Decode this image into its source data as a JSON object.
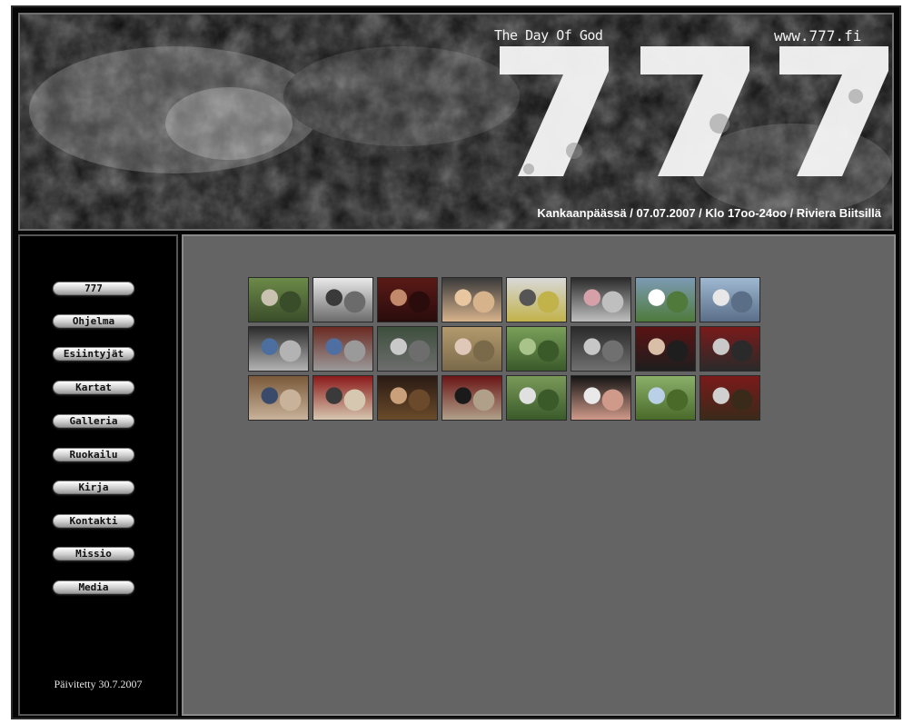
{
  "banner": {
    "logo_text": "777",
    "tagline": "The Day Of God",
    "url": "www.777.fi",
    "event_info": "Kankaanpäässä / 07.07.2007 / Klo 17oo-24oo / Riviera Biitsillä"
  },
  "nav": {
    "items": [
      {
        "label": "777"
      },
      {
        "label": "Ohjelma"
      },
      {
        "label": "Esiintyjät"
      },
      {
        "label": "Kartat"
      },
      {
        "label": "Galleria"
      },
      {
        "label": "Ruokailu"
      },
      {
        "label": "Kirja"
      },
      {
        "label": "Kontakti"
      },
      {
        "label": "Missio"
      },
      {
        "label": "Media"
      }
    ]
  },
  "footer": {
    "updated": "Päivitetty 30.7.2007"
  },
  "gallery": {
    "thumbnails": [
      {
        "colors": [
          "#6c8a48",
          "#c9c2b0",
          "#3a4d2a"
        ]
      },
      {
        "colors": [
          "#e9e9e9",
          "#3a3a3a",
          "#6b6b6b"
        ]
      },
      {
        "colors": [
          "#5a1a16",
          "#c28a6a",
          "#2a0c0c"
        ]
      },
      {
        "colors": [
          "#3a3a3a",
          "#e8c7a0",
          "#d7b38c"
        ]
      },
      {
        "colors": [
          "#d8d8d8",
          "#555555",
          "#c2b24a"
        ]
      },
      {
        "colors": [
          "#2b2b2b",
          "#d6a0a8",
          "#bfbfbf"
        ]
      },
      {
        "colors": [
          "#7c9bb4",
          "#ffffff",
          "#4f7a3b"
        ]
      },
      {
        "colors": [
          "#9fb8d2",
          "#e7e7e7",
          "#5a6e88"
        ]
      },
      {
        "colors": [
          "#2c2c2c",
          "#4c6fa0",
          "#b3b3b3"
        ]
      },
      {
        "colors": [
          "#6b2a22",
          "#4f6fa3",
          "#9a9a9a"
        ]
      },
      {
        "colors": [
          "#3d4f3d",
          "#c9c9c9",
          "#6d6d6d"
        ]
      },
      {
        "colors": [
          "#b39a6d",
          "#e0c8b8",
          "#7a6a4a"
        ]
      },
      {
        "colors": [
          "#7aa05a",
          "#a9c48a",
          "#3a5a2a"
        ]
      },
      {
        "colors": [
          "#2a2a2a",
          "#c7c7c7",
          "#707070"
        ]
      },
      {
        "colors": [
          "#5a1313",
          "#d9bfa8",
          "#1e1e1e"
        ]
      },
      {
        "colors": [
          "#7a1a1a",
          "#c9c9c9",
          "#2a2a2a"
        ]
      },
      {
        "colors": [
          "#7a5a3a",
          "#3a4a6a",
          "#c8b29a"
        ]
      },
      {
        "colors": [
          "#8a1a1a",
          "#3a3a3a",
          "#d6c7b0"
        ]
      },
      {
        "colors": [
          "#2a1a14",
          "#c9a07a",
          "#6a4a2a"
        ]
      },
      {
        "colors": [
          "#6a1616",
          "#1a1a1a",
          "#b0a08a"
        ]
      },
      {
        "colors": [
          "#7a9a5a",
          "#e0e0e0",
          "#3a5a2a"
        ]
      },
      {
        "colors": [
          "#141414",
          "#e9e9e9",
          "#cf9a8a"
        ]
      },
      {
        "colors": [
          "#8ab06a",
          "#b9d0e6",
          "#4a6a2a"
        ]
      },
      {
        "colors": [
          "#7a1a1a",
          "#d0d0d0",
          "#3a2a1a"
        ]
      }
    ]
  },
  "colors": {
    "page_bg": "#ffffff",
    "frame_bg": "#050505",
    "content_bg": "#646464",
    "button_gradient_top": "#ffffff",
    "button_gradient_bottom": "#9a9a9a"
  }
}
